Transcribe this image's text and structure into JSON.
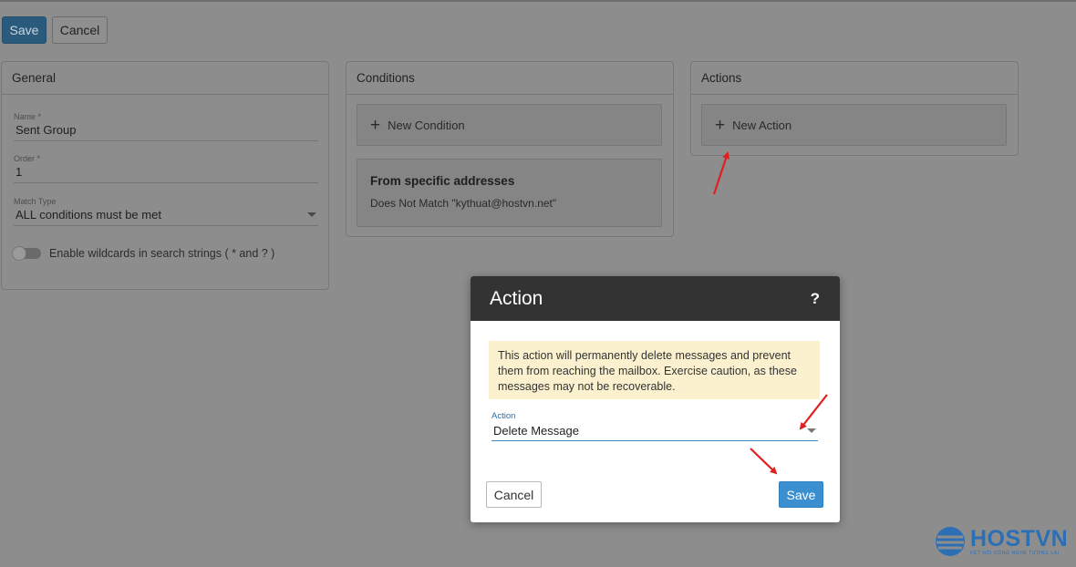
{
  "toolbar": {
    "save_label": "Save",
    "cancel_label": "Cancel"
  },
  "general": {
    "title": "General",
    "name": {
      "label": "Name *",
      "value": "Sent Group"
    },
    "order": {
      "label": "Order *",
      "value": "1"
    },
    "match_type": {
      "label": "Match Type",
      "value": "ALL conditions must be met"
    },
    "wildcards_label": "Enable wildcards in search strings ( * and ? )"
  },
  "conditions": {
    "title": "Conditions",
    "new_label": "New Condition",
    "items": [
      {
        "title": "From specific addresses",
        "description": "Does Not Match \"kythuat@hostvn.net\""
      }
    ]
  },
  "actions": {
    "title": "Actions",
    "new_label": "New Action"
  },
  "modal": {
    "title": "Action",
    "help": "?",
    "warning": "This action will permanently delete messages and prevent them from reaching the mailbox. Exercise caution, as these messages may not be recoverable.",
    "action_field": {
      "label": "Action",
      "value": "Delete Message"
    },
    "cancel_label": "Cancel",
    "save_label": "Save"
  },
  "branding": {
    "name": "HOSTVN",
    "tagline": "KẾT NỐI CÔNG NGHỆ TƯƠNG LAI"
  },
  "colors": {
    "primary": "#3a8fd0",
    "modal_header": "#333333",
    "warning_bg": "#fcf1cf",
    "annotation_arrow": "#e02020"
  }
}
